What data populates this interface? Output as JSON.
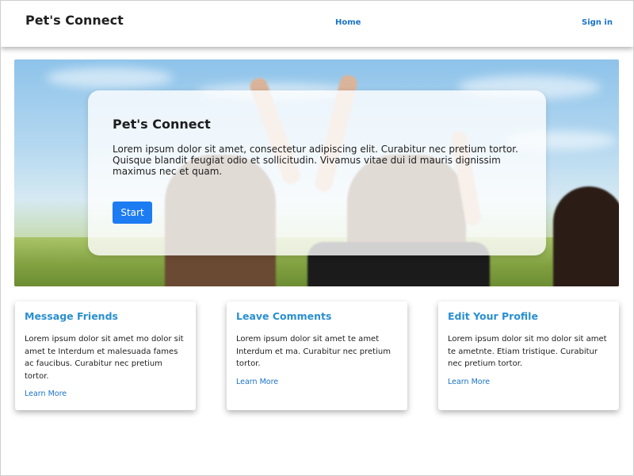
{
  "navbar": {
    "brand": "Pet's Connect",
    "links": {
      "home": "Home",
      "sign_in": "Sign in"
    }
  },
  "hero": {
    "title": "Pet's Connect",
    "text": "Lorem ipsum dolor sit amet, consectetur adipiscing elit. Curabitur nec pretium tortor. Quisque blandit feugiat odio et sollicitudin. Vivamus vitae dui id mauris dignissim maximus nec et quam.",
    "button_label": "Start"
  },
  "features": [
    {
      "title": "Message Friends",
      "text": "Lorem ipsum dolor sit amet mo dolor sit amet te Interdum et malesuada fames ac faucibus. Curabitur nec pretium tortor.",
      "link": "Learn More"
    },
    {
      "title": "Leave Comments",
      "text": "Lorem ipsum dolor sit amet te amet Interdum et ma. Curabitur nec pretium tortor.",
      "link": "Learn More"
    },
    {
      "title": "Edit Your Profile",
      "text": "Lorem ipsum dolor sit mo dolor sit amet te ametnte. Etiam tristique. Curabitur nec pretium tortor.",
      "link": "Learn More"
    }
  ],
  "colors": {
    "accent": "#1d7cf2",
    "link": "#1a73c8",
    "card_title": "#2a8fd0"
  }
}
